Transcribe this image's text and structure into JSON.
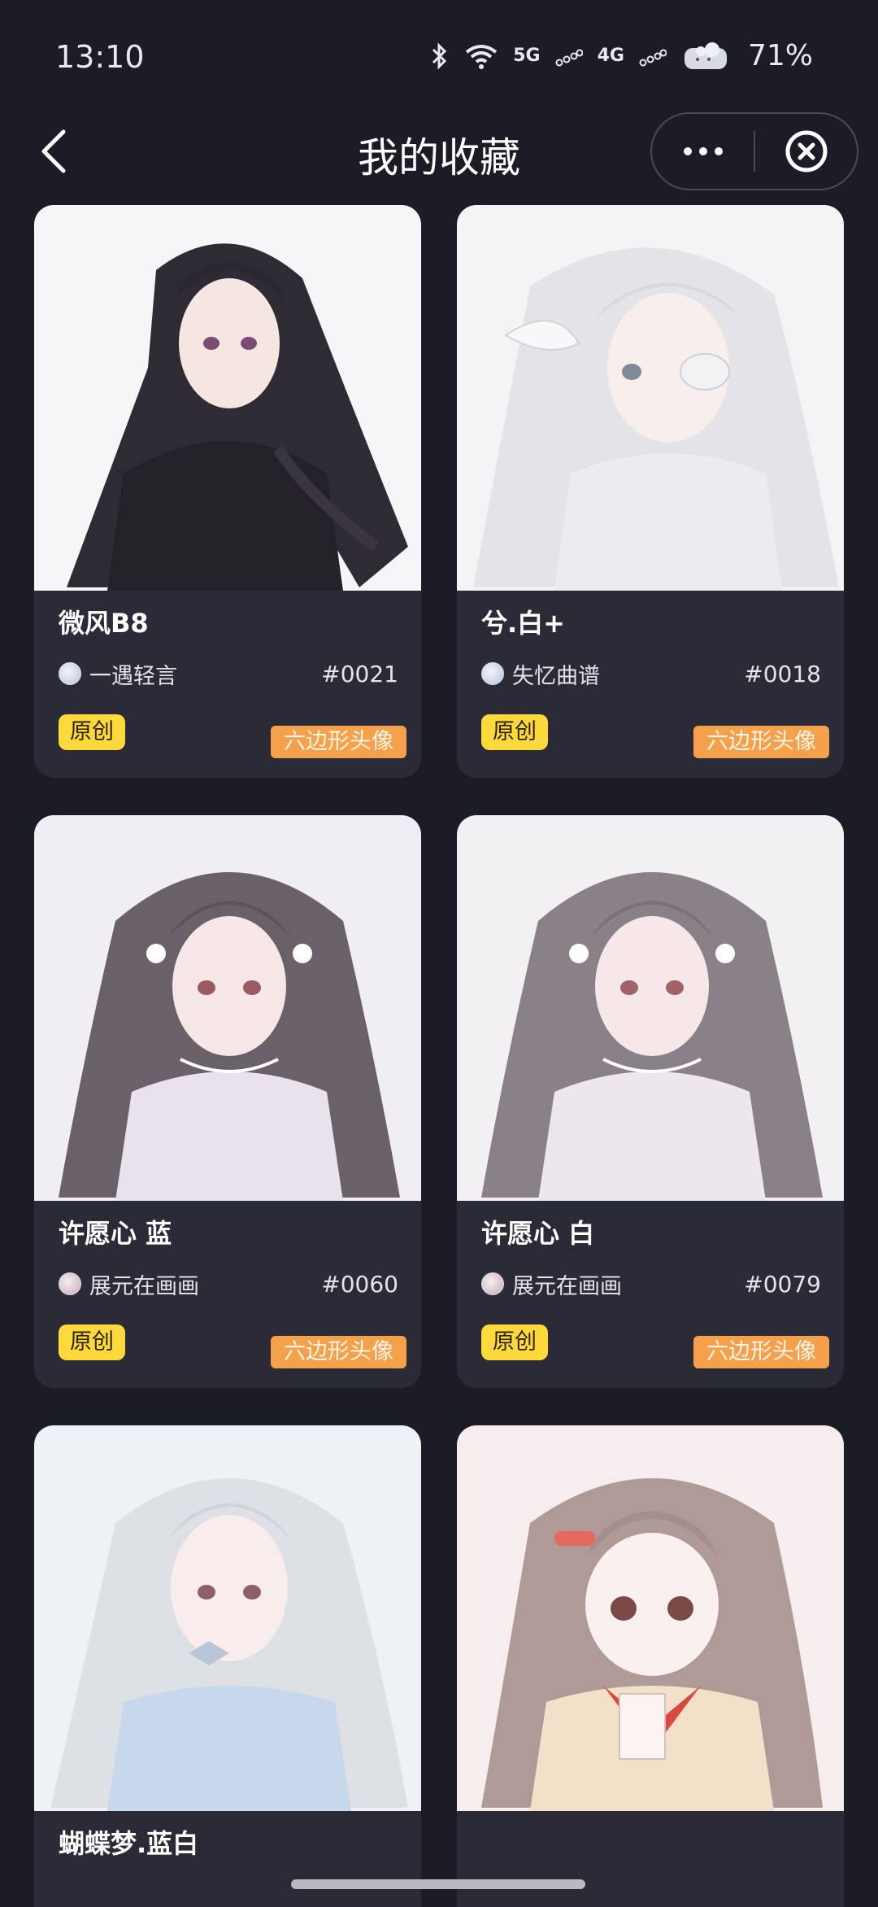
{
  "status_bar": {
    "time": "13:10",
    "net_5g": "5G",
    "net_4g": "4G",
    "battery": "71%"
  },
  "nav": {
    "title": "我的收藏",
    "back_icon": "chevron-left-icon",
    "more_icon": "more-dots-icon",
    "close_icon": "close-circle-icon"
  },
  "cards": [
    {
      "title": "微风B8",
      "author": "一遇轻言",
      "serial": "#0021",
      "tag_original": "原创",
      "tag_type": "六边形头像"
    },
    {
      "title": "兮.白+",
      "author": "失忆曲谱",
      "serial": "#0018",
      "tag_original": "原创",
      "tag_type": "六边形头像"
    },
    {
      "title": "许愿心 蓝",
      "author": "展元在画画",
      "serial": "#0060",
      "tag_original": "原创",
      "tag_type": "六边形头像"
    },
    {
      "title": "许愿心 白",
      "author": "展元在画画",
      "serial": "#0079",
      "tag_original": "原创",
      "tag_type": "六边形头像"
    },
    {
      "title": "蝴蝶梦.蓝白"
    },
    {
      "title": ""
    }
  ],
  "colors": {
    "background": "#1c1c27",
    "card": "#2b2b38",
    "tag_original": "#ffd83b",
    "tag_type": "#f5a04a"
  }
}
